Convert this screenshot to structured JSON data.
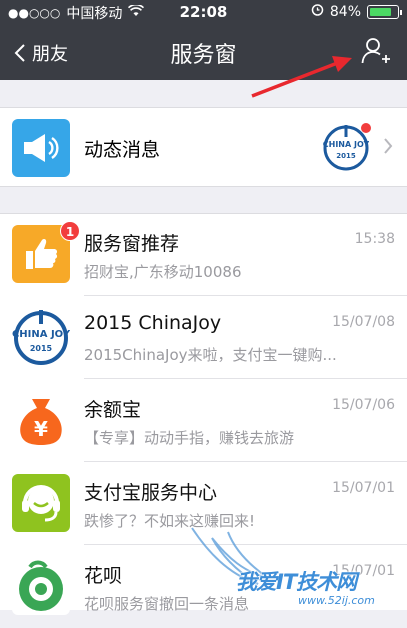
{
  "status_bar": {
    "signal_dots": "●●○○○",
    "carrier": "中国移动",
    "time": "22:08",
    "battery_percent": "84%",
    "battery_level": 0.84,
    "icons": [
      "wifi-icon",
      "alarm-icon",
      "battery-icon"
    ]
  },
  "nav": {
    "back_label": "朋友",
    "title": "服务窗",
    "add_icon": "add-user-icon"
  },
  "dynamic": {
    "label": "动态消息",
    "avatar_text": "CHINA JOY",
    "avatar_year": "2015"
  },
  "items": [
    {
      "name": "服务窗推荐",
      "message": "招财宝,广东移动10086",
      "date": "15:38",
      "badge": "1",
      "icon": "thumbs-up-icon",
      "color": "#f7a928"
    },
    {
      "name": "2015 ChinaJoy",
      "message": "2015ChinaJoy来啦，支付宝一键购...",
      "date": "15/07/08",
      "icon": "chinajoy-logo",
      "color": "#1c5a9e",
      "logo_text": "CHINA JOY",
      "logo_year": "2015"
    },
    {
      "name": "余额宝",
      "message": "【专享】动动手指，赚钱去旅游",
      "date": "15/07/06",
      "icon": "money-bag-icon",
      "color": "#f7671d",
      "glyph": "¥"
    },
    {
      "name": "支付宝服务中心",
      "message": "跌惨了？不如来这赚回来!",
      "date": "15/07/01",
      "icon": "headset-icon",
      "color": "#8fc31f"
    },
    {
      "name": "花呗",
      "message": "花呗服务窗撤回一条消息",
      "date": "15/07/01",
      "icon": "huabei-icon",
      "color": "#3aa655"
    }
  ],
  "watermark": {
    "text": "我爱IT技术网",
    "url": "www.52ij.com"
  },
  "colors": {
    "nav_bg": "#3a3d44",
    "arrow": "#e8282e",
    "badge": "#f23d3d"
  }
}
